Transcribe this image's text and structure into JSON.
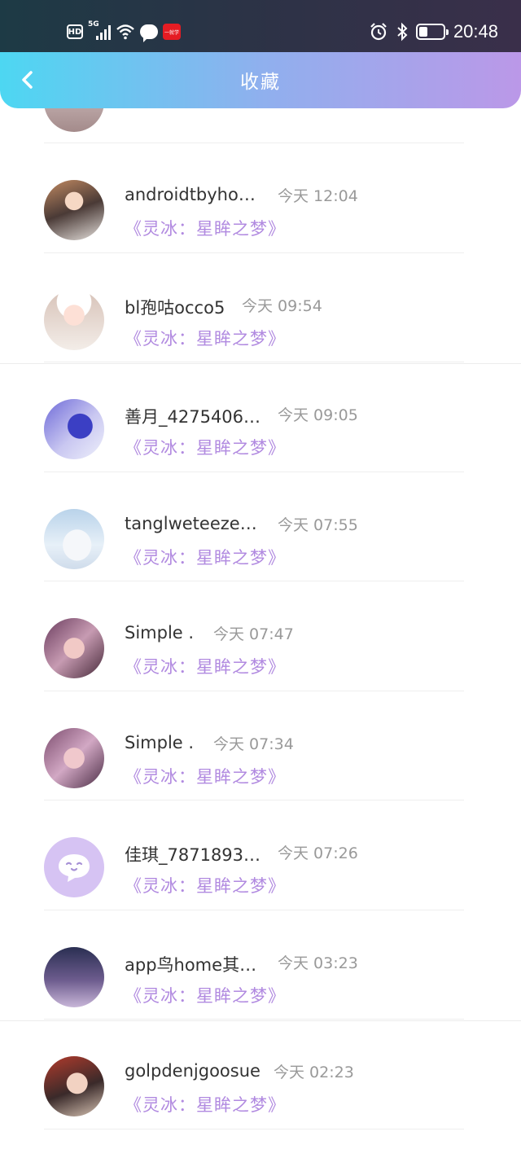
{
  "status_bar": {
    "hd_label": "HD",
    "network": "5G",
    "app_badge": "一就学",
    "time": "20:48"
  },
  "header": {
    "back_icon": "chevron-left-icon",
    "title": "收藏"
  },
  "list": {
    "items": [
      {
        "name": "androidtbyho…",
        "time": "今天 12:04",
        "tag": "《灵冰：星眸之梦》"
      },
      {
        "name": "bl孢咕occo5",
        "time": "今天 09:54",
        "tag": "《灵冰：星眸之梦》"
      },
      {
        "name": "善月_4275406…",
        "time": "今天 09:05",
        "tag": "《灵冰：星眸之梦》"
      },
      {
        "name": "tanglweteeze…",
        "time": "今天 07:55",
        "tag": "《灵冰：星眸之梦》"
      },
      {
        "name": "Simple .",
        "time": "今天 07:47",
        "tag": "《灵冰：星眸之梦》"
      },
      {
        "name": "Simple .",
        "time": "今天 07:34",
        "tag": "《灵冰：星眸之梦》"
      },
      {
        "name": "佳琪_7871893…",
        "time": "今天 07:26",
        "tag": "《灵冰：星眸之梦》"
      },
      {
        "name": "app鸟home其…",
        "time": "今天 03:23",
        "tag": "《灵冰：星眸之梦》"
      },
      {
        "name": "golpdenjgoosue",
        "time": "今天 02:23",
        "tag": "《灵冰：星眸之梦》"
      }
    ]
  },
  "colors": {
    "accent": "#b18ae0",
    "header_start": "#4dd7f2",
    "header_end": "#bb98e8"
  }
}
